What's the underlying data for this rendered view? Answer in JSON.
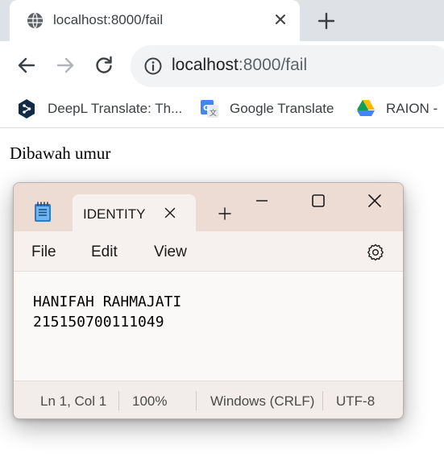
{
  "browser": {
    "tab": {
      "title": "localhost:8000/fail",
      "icon": "globe-icon"
    },
    "address": {
      "host": "localhost",
      "path": ":8000/fail"
    },
    "bookmarks": [
      {
        "label": "DeepL Translate: Th...",
        "icon": "deepl-icon"
      },
      {
        "label": "Google Translate",
        "icon": "google-translate-icon"
      },
      {
        "label": "RAION -",
        "icon": "google-drive-icon"
      }
    ]
  },
  "page": {
    "text": "Dibawah umur"
  },
  "notepad": {
    "tab_title": "IDENTITY",
    "menu": {
      "file": "File",
      "edit": "Edit",
      "view": "View"
    },
    "content": [
      "HANIFAH RAHMAJATI",
      "215150700111049"
    ],
    "status": {
      "position": "Ln 1, Col 1",
      "zoom": "100%",
      "line_ending": "Windows (CRLF)",
      "encoding": "UTF-8"
    }
  },
  "colors": {
    "titlebar": "#ecdcd4",
    "chrome_tabstrip": "#dee1e6",
    "omnibox": "#f1f3f4"
  }
}
